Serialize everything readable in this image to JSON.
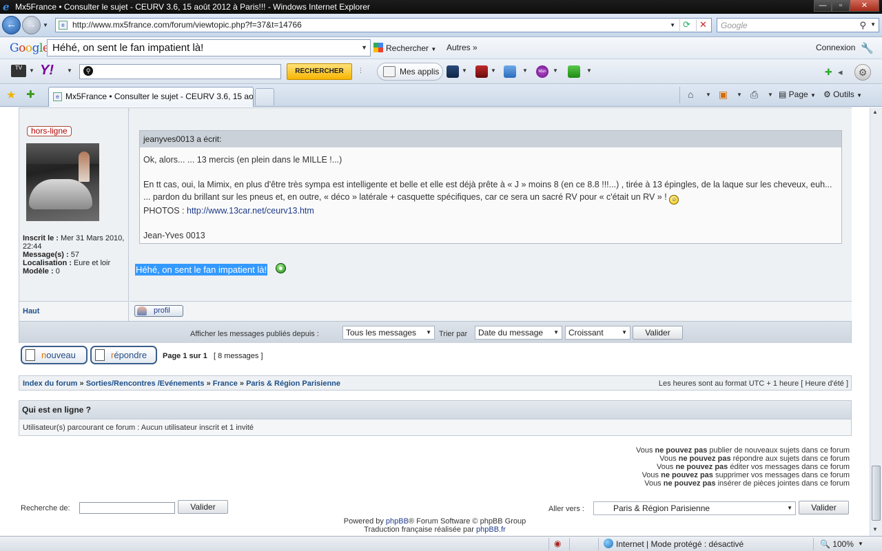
{
  "window": {
    "title": "Mx5France • Consulter le sujet - CEURV 3.6, 15 août 2012 à Paris!!! - Windows Internet Explorer",
    "buttons": {
      "minimize": "—",
      "maximize": "▫",
      "close": "✕"
    }
  },
  "addressbar": {
    "url": "http://www.mx5france.com/forum/viewtopic.php?f=37&t=14766",
    "search_placeholder": "Google"
  },
  "google_toolbar": {
    "logo": [
      "G",
      "o",
      "o",
      "g",
      "l",
      "e"
    ],
    "query": "Héhé, on sent le fan impatient là!",
    "search_button": "Rechercher",
    "more_button": "Autres »",
    "connect": "Connexion"
  },
  "yahoo_toolbar": {
    "tv_label": "TV",
    "logo": "Y!",
    "search_button": "RECHERCHER",
    "apps_button": "Mes applis",
    "msn_label": "Msn"
  },
  "tabs": {
    "active_title": "Mx5France • Consulter le sujet - CEURV 3.6, 15 ao...",
    "page_menu": "Page",
    "tools_menu": "Outils"
  },
  "post": {
    "status_badge": "hors-ligne",
    "user": {
      "registered_label": "Inscrit le :",
      "registered_value": "Mer 31 Mars 2010, 22:44",
      "messages_label": "Message(s) :",
      "messages_value": "57",
      "location_label": "Localisation :",
      "location_value": "Eure et loir",
      "model_label": "Modèle :",
      "model_value": "0"
    },
    "quote": {
      "header": "jeanyves0013 a écrit:",
      "line1": "Ok, alors... ... 13 mercis (en plein dans le MILLE !...)",
      "line2": "En tt cas, oui, la Mimix, en plus d'être très sympa est intelligente et belle et elle est déjà prête à « J » moins 8 (en ce 8.8 !!!...) , tirée à 13 épingles, de la laque sur les cheveux, euh... ... pardon du brillant sur les pneus et, en outre, « déco » latérale + casquette spécifiques, car ce sera un sacré RV pour « c'était un RV » !",
      "photos_label": "PHOTOS :",
      "photos_link": "http://www.13car.net/ceurv13.htm",
      "signature": "Jean-Yves 0013"
    },
    "reply_text": "Héhé, on sent le fan impatient là!",
    "top_link": "Haut",
    "profile_button": "profil"
  },
  "filter": {
    "show_label": "Afficher les messages publiés depuis :",
    "show_value": "Tous les messages",
    "sort_label": "Trier par",
    "sort_value": "Date du message",
    "order_value": "Croissant",
    "submit": "Valider"
  },
  "actions": {
    "new_first": "n",
    "new_rest": "ouveau",
    "reply_first": "r",
    "reply_rest": "épondre",
    "page_info_bold": "Page 1 sur 1",
    "page_info_count": "[ 8 messages ]"
  },
  "breadcrumb": {
    "items": [
      "Index du forum",
      "Sorties/Rencontres /Evénements",
      "France",
      "Paris & Région Parisienne"
    ],
    "separator": "»",
    "timezone": "Les heures sont au format UTC + 1 heure [ Heure d'été ]"
  },
  "online": {
    "title": "Qui est en ligne ?",
    "text": "Utilisateur(s) parcourant ce forum : Aucun utilisateur inscrit et 1 invité"
  },
  "permissions": [
    {
      "pre": "Vous",
      "bold": "ne pouvez pas",
      "post": "publier de nouveaux sujets dans ce forum"
    },
    {
      "pre": "Vous",
      "bold": "ne pouvez pas",
      "post": "répondre aux sujets dans ce forum"
    },
    {
      "pre": "Vous",
      "bold": "ne pouvez pas",
      "post": "éditer vos messages dans ce forum"
    },
    {
      "pre": "Vous",
      "bold": "ne pouvez pas",
      "post": "supprimer vos messages dans ce forum"
    },
    {
      "pre": "Vous",
      "bold": "ne pouvez pas",
      "post": "insérer de pièces jointes dans ce forum"
    }
  ],
  "search": {
    "label": "Recherche de:",
    "submit": "Valider"
  },
  "jump": {
    "label": "Aller vers :",
    "value": "Paris & Région Parisienne",
    "submit": "Valider"
  },
  "footer": {
    "powered_pre": "Powered by",
    "powered_link": "phpBB",
    "powered_post": "® Forum Software © phpBB Group",
    "translation_pre": "Traduction française réalisée par",
    "translation_link": "phpBB.fr"
  },
  "statusbar": {
    "zone": "Internet | Mode protégé : désactivé",
    "zoom": "100%"
  },
  "colors": {
    "selection": "#3399ff",
    "link": "#1d4f8a",
    "badge_red": "#b20000",
    "accent_orange": "#e07000"
  }
}
